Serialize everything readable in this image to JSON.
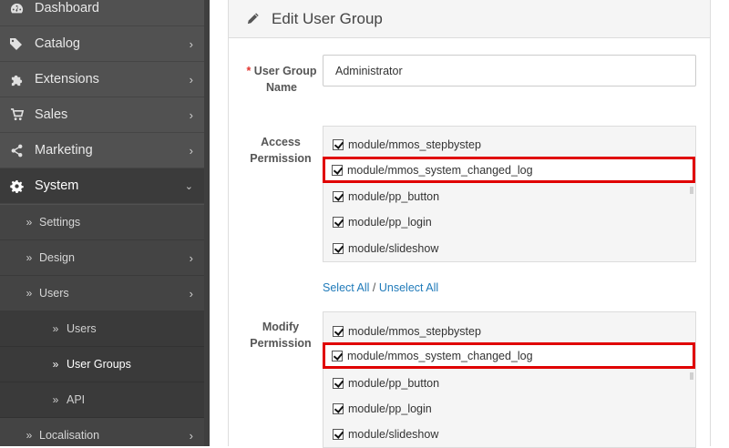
{
  "sidebar": {
    "items": [
      {
        "label": "Dashboard",
        "icon": "dashboard-icon"
      },
      {
        "label": "Catalog",
        "icon": "tags-icon"
      },
      {
        "label": "Extensions",
        "icon": "puzzle-icon"
      },
      {
        "label": "Sales",
        "icon": "cart-icon"
      },
      {
        "label": "Marketing",
        "icon": "share-icon"
      },
      {
        "label": "System",
        "icon": "cog-icon"
      }
    ],
    "system_children": [
      {
        "label": "Settings"
      },
      {
        "label": "Design"
      },
      {
        "label": "Users"
      }
    ],
    "users_children": [
      {
        "label": "Users"
      },
      {
        "label": "User Groups"
      },
      {
        "label": "API"
      }
    ],
    "localisation": {
      "label": "Localisation"
    }
  },
  "panel": {
    "title": "Edit User Group",
    "group_name_label_req": "*",
    "group_name_label": "User Group Name",
    "group_name_value": "Administrator",
    "access_label": "Access Permission",
    "modify_label": "Modify Permission",
    "access_items": [
      "module/mmos_stepbystep",
      "module/mmos_system_changed_log",
      "module/pp_button",
      "module/pp_login",
      "module/slideshow"
    ],
    "modify_items": [
      "module/mmos_stepbystep",
      "module/mmos_system_changed_log",
      "module/pp_button",
      "module/pp_login",
      "module/slideshow"
    ],
    "select_all": "Select All",
    "separator": "/",
    "unselect_all": "Unselect All"
  },
  "colors": {
    "highlight": "#e00000",
    "link": "#1f7ab9",
    "sidebar": "#515151"
  }
}
